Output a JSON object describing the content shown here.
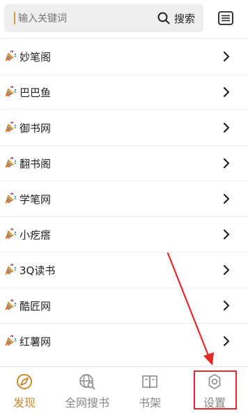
{
  "search": {
    "placeholder": "输入关键词",
    "button_label": "搜索",
    "icon": "search-icon"
  },
  "menu_icon": "list-menu-icon",
  "list_icon": "party-popper-icon",
  "items": [
    {
      "label": "妙笔阁"
    },
    {
      "label": "巴巴鱼"
    },
    {
      "label": "御书网"
    },
    {
      "label": "翻书阁"
    },
    {
      "label": "学笔网"
    },
    {
      "label": "小疙瘩"
    },
    {
      "label": "3Q读书"
    },
    {
      "label": "酷匠网"
    },
    {
      "label": "红薯网"
    }
  ],
  "nav": {
    "tabs": [
      {
        "label": "发现",
        "icon": "compass-icon",
        "active": true
      },
      {
        "label": "全网搜书",
        "icon": "globe-search-icon",
        "active": false
      },
      {
        "label": "书架",
        "icon": "open-book-icon",
        "active": false
      },
      {
        "label": "设置",
        "icon": "gear-icon",
        "active": false
      }
    ]
  },
  "colors": {
    "accent": "#c98a2b",
    "annotation": "#e32b2b",
    "inactive": "#888888"
  }
}
